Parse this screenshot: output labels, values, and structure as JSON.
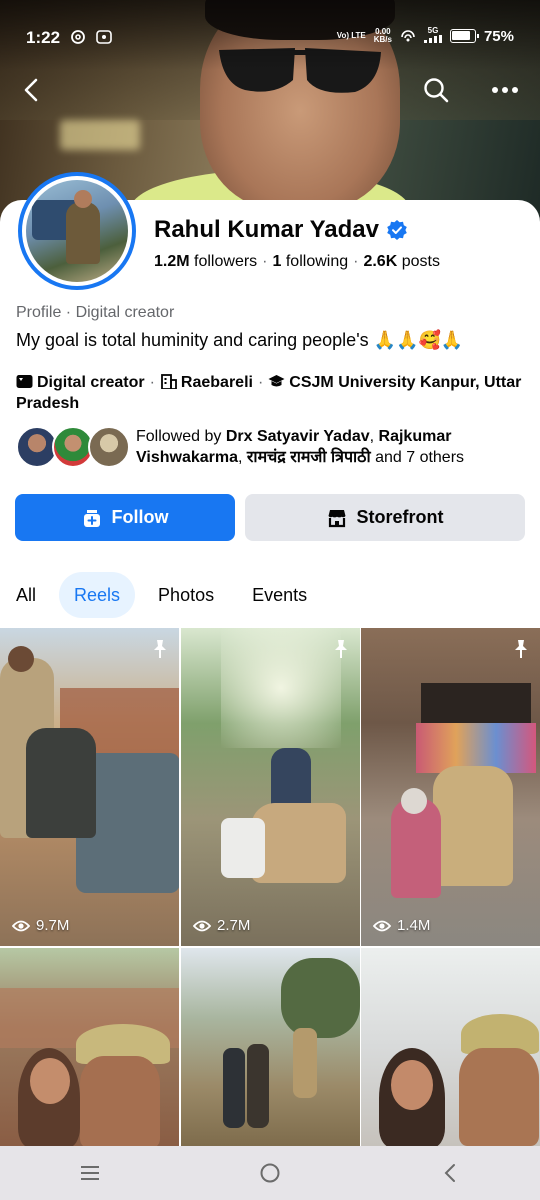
{
  "status": {
    "time": "1:22",
    "network": "Vo) LTE",
    "speed_value": "0.00",
    "speed_unit": "KB/s",
    "signal": "5G",
    "battery": "75%"
  },
  "profile": {
    "name": "Rahul Kumar Yadav",
    "followers_count": "1.2M",
    "followers_label": "followers",
    "following_count": "1",
    "following_label": "following",
    "posts_count": "2.6K",
    "posts_label": "posts",
    "category": "Profile · Digital creator",
    "bio": "My goal is total huminity and caring people's 🙏🙏🥰🙏",
    "detail_creator": "Digital creator",
    "detail_city": "Raebareli",
    "detail_education": "CSJM University Kanpur, Uttar Pradesh"
  },
  "followed_by": {
    "prefix": "Followed by",
    "name1": "Drx Satyavir Yadav",
    "name2": "Rajkumar Vishwakarma",
    "name3": "रामचंद्र रामजी त्रिपाठी",
    "suffix": "and 7 others"
  },
  "buttons": {
    "follow": "Follow",
    "storefront": "Storefront"
  },
  "tabs": [
    "All",
    "Reels",
    "Photos",
    "Events"
  ],
  "active_tab": "Reels",
  "reels": [
    {
      "views": "9.7M",
      "pinned": true
    },
    {
      "views": "2.7M",
      "pinned": true
    },
    {
      "views": "1.4M",
      "pinned": true
    },
    {
      "views": "",
      "pinned": false
    },
    {
      "views": "",
      "pinned": false
    },
    {
      "views": "",
      "pinned": false
    }
  ],
  "colors": {
    "accent": "#1877f2",
    "secondary_button": "#e4e6eb",
    "muted_text": "#65676b",
    "active_tab_bg": "#e7f3ff"
  }
}
